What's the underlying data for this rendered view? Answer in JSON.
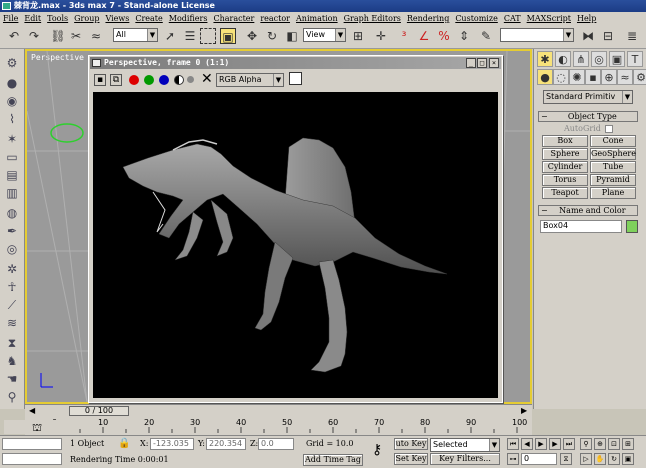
{
  "title": "棘背龙.max - 3ds max 7 - Stand-alone License",
  "menu": [
    "File",
    "Edit",
    "Tools",
    "Group",
    "Views",
    "Create",
    "Modifiers",
    "Character",
    "reactor",
    "Animation",
    "Graph Editors",
    "Rendering",
    "Customize",
    "CAT",
    "MAXScript",
    "Help"
  ],
  "toolbar": {
    "filter": "All",
    "refcoord": "View"
  },
  "viewport": {
    "label": "Perspective"
  },
  "render_window": {
    "title": "Perspective, frame 0 (1:1)",
    "channel": "RGB Alpha"
  },
  "command_panel": {
    "dropdown": "Standard Primitiv",
    "object_type_header": "Object Type",
    "autogrid": "AutoGrid",
    "buttons": [
      "Box",
      "Cone",
      "Sphere",
      "GeoSphere",
      "Cylinder",
      "Tube",
      "Torus",
      "Pyramid",
      "Teapot",
      "Plane"
    ],
    "name_color_header": "Name and Color",
    "object_name": "Box04",
    "object_color": "#7fd15c"
  },
  "timeline": {
    "slider": "0 / 100",
    "ticks": [
      "0",
      "10",
      "20",
      "30",
      "40",
      "50",
      "60",
      "70",
      "80",
      "90",
      "100"
    ]
  },
  "status": {
    "selected": "1 Object",
    "x_label": "X:",
    "x": "-123.035",
    "y_label": "Y:",
    "y": "220.354",
    "z_label": "Z:",
    "z": "0.0",
    "grid": "Grid = 10.0",
    "prompt": "Rendering Time  0:00:01",
    "add_time_tag": "Add Time Tag",
    "auto_key": "uto Key",
    "set_key": "Set Key",
    "key_mode": "Selected",
    "key_filters": "Key Filters...",
    "frame": "0"
  }
}
